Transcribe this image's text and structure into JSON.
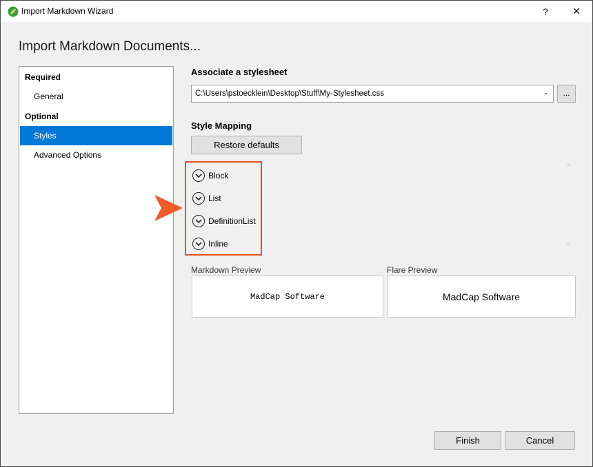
{
  "window": {
    "title": "Import Markdown Wizard",
    "help_label": "?",
    "close_label": "✕"
  },
  "page": {
    "heading": "Import Markdown Documents..."
  },
  "nav": {
    "required_label": "Required",
    "optional_label": "Optional",
    "items": [
      {
        "label": "General",
        "selected": false
      },
      {
        "label": "Styles",
        "selected": true
      },
      {
        "label": "Advanced Options",
        "selected": false
      }
    ]
  },
  "stylesheet": {
    "section_label": "Associate a stylesheet",
    "path_value": "C:\\Users\\pstoecklein\\Desktop\\Stuff\\My-Stylesheet.css",
    "browse_label": "..."
  },
  "mapping": {
    "section_label": "Style Mapping",
    "restore_label": "Restore defaults",
    "items": [
      "Block",
      "List",
      "DefinitionList",
      "Inline"
    ]
  },
  "preview": {
    "markdown_label": "Markdown Preview",
    "markdown_text": "MadCap Software",
    "flare_label": "Flare Preview",
    "flare_text": "MadCap Software"
  },
  "footer": {
    "finish_label": "Finish",
    "cancel_label": "Cancel"
  },
  "colors": {
    "selection": "#0078d7",
    "highlight": "#e84e1b",
    "callout_arrow": "#f05a28"
  },
  "icons": {
    "app": "madcap-leaf-icon",
    "expand": "chevron-down-circle-icon",
    "callout": "arrow-pointer-icon"
  }
}
